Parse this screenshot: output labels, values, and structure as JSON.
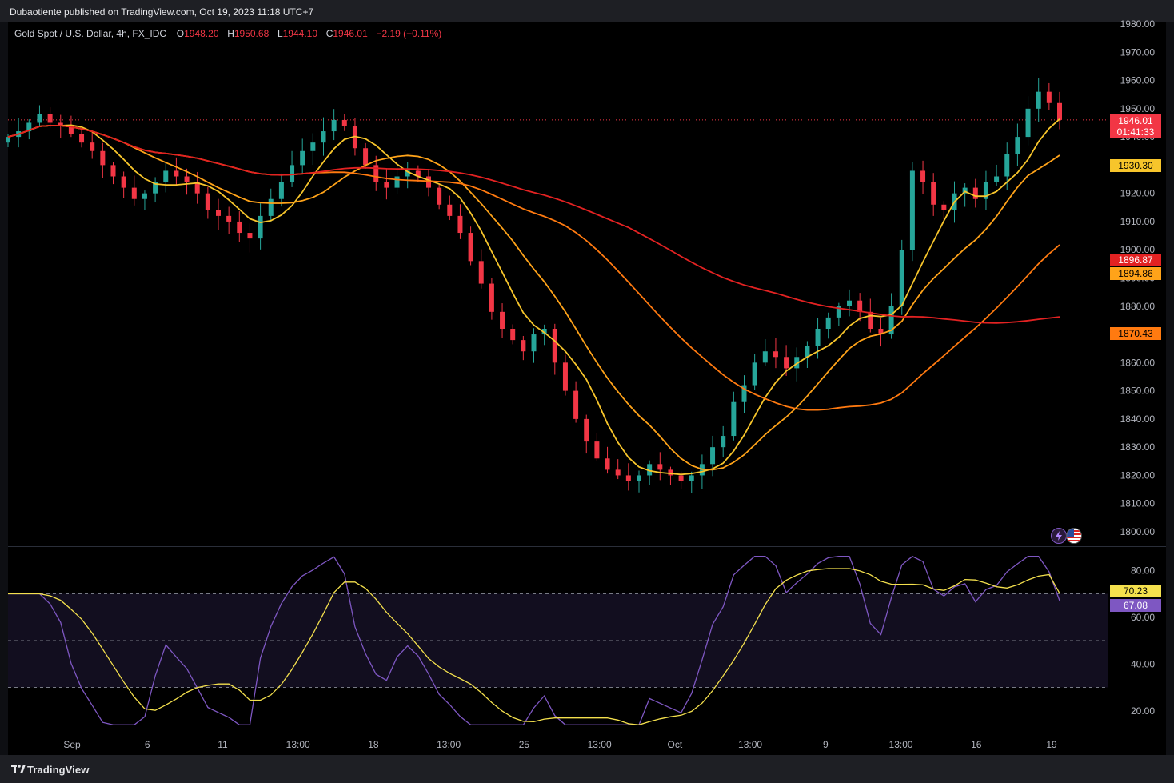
{
  "header": {
    "published_by": "Dubaotiente published on TradingView.com, Oct 19, 2023 11:18 UTC+7"
  },
  "legend": {
    "symbol": "Gold Spot / U.S. Dollar, 4h, FX_IDC",
    "open_label": "O",
    "open": "1948.20",
    "high_label": "H",
    "high": "1950.68",
    "low_label": "L",
    "low": "1944.10",
    "close_label": "C",
    "close": "1946.01",
    "change": "−2.19 (−0.11%)"
  },
  "price_axis": {
    "ticks": [
      "1980.00",
      "1970.00",
      "1960.00",
      "1950.00",
      "1940.00",
      "1930.00",
      "1920.00",
      "1910.00",
      "1900.00",
      "1890.00",
      "1880.00",
      "1870.00",
      "1860.00",
      "1850.00",
      "1840.00",
      "1830.00",
      "1820.00",
      "1810.00",
      "1800.00"
    ]
  },
  "price_tags": {
    "last_price": "1946.01",
    "countdown": "01:41:33",
    "ma_1": "1930.30",
    "ma_2": "1896.87",
    "ma_3": "1894.86",
    "ma_4": "1870.43"
  },
  "rsi_axis": {
    "ticks": [
      "80.00",
      "60.00",
      "40.00",
      "20.00"
    ]
  },
  "rsi_tags": {
    "signal": "70.23",
    "rsi": "67.08"
  },
  "time_axis": {
    "labels": [
      "Sep",
      "6",
      "11",
      "13:00",
      "18",
      "13:00",
      "25",
      "13:00",
      "Oct",
      "13:00",
      "9",
      "13:00",
      "16",
      "19"
    ]
  },
  "footer": {
    "brand": "TradingView"
  },
  "colors": {
    "up": "#26a69a",
    "down": "#f23645",
    "ma_yellow": "#f7c52b",
    "ma_amber": "#ffa319",
    "ma_red": "#e32222",
    "ma_orange": "#ff7a10",
    "rsi_line": "#7e57c2",
    "rsi_signal": "#f4e04d"
  },
  "chart_data": {
    "type": "candlestick",
    "symbol": "Gold Spot / U.S. Dollar, 4h, FX_IDC",
    "ylim": [
      1800,
      1980
    ],
    "x": [
      "Sep",
      "6",
      "11",
      "13:00",
      "18",
      "13:00",
      "25",
      "13:00",
      "Oct",
      "13:00",
      "9",
      "13:00",
      "16",
      "19"
    ],
    "closes": [
      1940,
      1942,
      1945,
      1948,
      1945,
      1944,
      1941,
      1938,
      1935,
      1930,
      1926,
      1922,
      1918,
      1920,
      1924,
      1928,
      1926,
      1924,
      1920,
      1914,
      1912,
      1910,
      1906,
      1904,
      1912,
      1918,
      1924,
      1930,
      1935,
      1938,
      1942,
      1946,
      1944,
      1936,
      1930,
      1924,
      1922,
      1926,
      1928,
      1926,
      1922,
      1916,
      1912,
      1906,
      1896,
      1888,
      1878,
      1872,
      1868,
      1864,
      1870,
      1872,
      1860,
      1850,
      1840,
      1832,
      1826,
      1822,
      1820,
      1818,
      1820,
      1824,
      1822,
      1820,
      1818,
      1820,
      1824,
      1830,
      1834,
      1846,
      1852,
      1860,
      1864,
      1862,
      1858,
      1862,
      1866,
      1872,
      1876,
      1880,
      1882,
      1878,
      1872,
      1870,
      1880,
      1900,
      1928,
      1924,
      1916,
      1914,
      1920,
      1922,
      1918,
      1924,
      1926,
      1934,
      1940,
      1950,
      1956,
      1952,
      1946.01
    ],
    "moving_averages": [
      {
        "value": "1930.30"
      },
      {
        "value": "1896.87"
      },
      {
        "value": "1894.86"
      },
      {
        "value": "1870.43"
      }
    ],
    "rsi": {
      "ylim": [
        10,
        90
      ],
      "levels": [
        30,
        50,
        70
      ],
      "last_rsi": 67.08,
      "last_signal": 70.23
    }
  }
}
